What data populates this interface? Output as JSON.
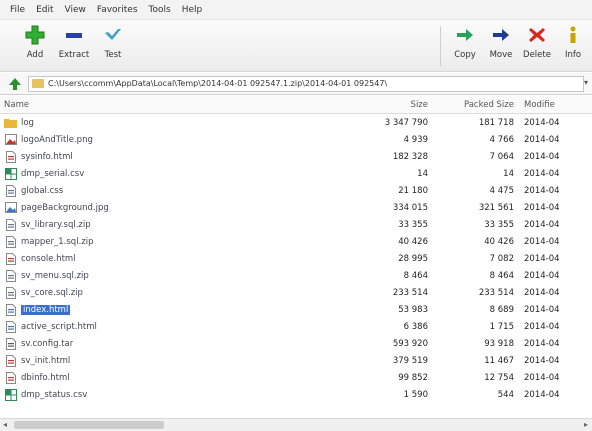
{
  "menu": [
    "File",
    "Edit",
    "View",
    "Favorites",
    "Tools",
    "Help"
  ],
  "toolbar": {
    "add": "Add",
    "extract": "Extract",
    "test": "Test",
    "copy": "Copy",
    "move": "Move",
    "delete": "Delete",
    "info": "Info"
  },
  "address": "C:\\Users\\ccomm\\AppData\\Local\\Temp\\2014-04-01 092547.1.zip\\2014-04-01 092547\\",
  "columns": {
    "name": "Name",
    "size": "Size",
    "packed": "Packed Size",
    "modified": "Modifie"
  },
  "files": [
    {
      "name": "log",
      "size": "3 347 790",
      "packed": "181 718",
      "modified": "2014-04",
      "icon": "folder-icon",
      "color": "#e8b83a"
    },
    {
      "name": "logoAndTitle.png",
      "size": "4 939",
      "packed": "4 766",
      "modified": "2014-04",
      "icon": "image-icon",
      "color": "#c0392b"
    },
    {
      "name": "sysinfo.html",
      "size": "182 328",
      "packed": "7 064",
      "modified": "2014-04",
      "icon": "html-icon",
      "color": "#c0392b"
    },
    {
      "name": "dmp_serial.csv",
      "size": "14",
      "packed": "14",
      "modified": "2014-04",
      "icon": "spreadsheet-icon",
      "color": "#2e8b57"
    },
    {
      "name": "global.css",
      "size": "21 180",
      "packed": "4 475",
      "modified": "2014-04",
      "icon": "css-icon",
      "color": "#5577aa"
    },
    {
      "name": "pageBackground.jpg",
      "size": "334 015",
      "packed": "321 561",
      "modified": "2014-04",
      "icon": "image-icon",
      "color": "#3a78c0"
    },
    {
      "name": "sv_library.sql.zip",
      "size": "33 355",
      "packed": "33 355",
      "modified": "2014-04",
      "icon": "archive-icon",
      "color": "#667788"
    },
    {
      "name": "mapper_1.sql.zip",
      "size": "40 426",
      "packed": "40 426",
      "modified": "2014-04",
      "icon": "archive-icon",
      "color": "#667788"
    },
    {
      "name": "console.html",
      "size": "28 995",
      "packed": "7 082",
      "modified": "2014-04",
      "icon": "html-icon",
      "color": "#c0392b"
    },
    {
      "name": "sv_menu.sql.zip",
      "size": "8 464",
      "packed": "8 464",
      "modified": "2014-04",
      "icon": "archive-icon",
      "color": "#667788"
    },
    {
      "name": "sv_core.sql.zip",
      "size": "233 514",
      "packed": "233 514",
      "modified": "2014-04",
      "icon": "archive-icon",
      "color": "#667788"
    },
    {
      "name": "index.html",
      "size": "53 983",
      "packed": "8 689",
      "modified": "2014-04",
      "icon": "html-icon",
      "color": "#3a78c0",
      "selected": true
    },
    {
      "name": "active_script.html",
      "size": "6 386",
      "packed": "1 715",
      "modified": "2014-04",
      "icon": "html-icon",
      "color": "#3a78c0"
    },
    {
      "name": "sv.config.tar",
      "size": "593 920",
      "packed": "93 918",
      "modified": "2014-04",
      "icon": "archive-icon",
      "color": "#555566"
    },
    {
      "name": "sv_init.html",
      "size": "379 519",
      "packed": "11 467",
      "modified": "2014-04",
      "icon": "html-icon",
      "color": "#c0392b"
    },
    {
      "name": "dbinfo.html",
      "size": "99 852",
      "packed": "12 754",
      "modified": "2014-04",
      "icon": "html-icon",
      "color": "#c0392b"
    },
    {
      "name": "dmp_status.csv",
      "size": "1 590",
      "packed": "544",
      "modified": "2014-04",
      "icon": "spreadsheet-icon",
      "color": "#2e8b57"
    }
  ]
}
